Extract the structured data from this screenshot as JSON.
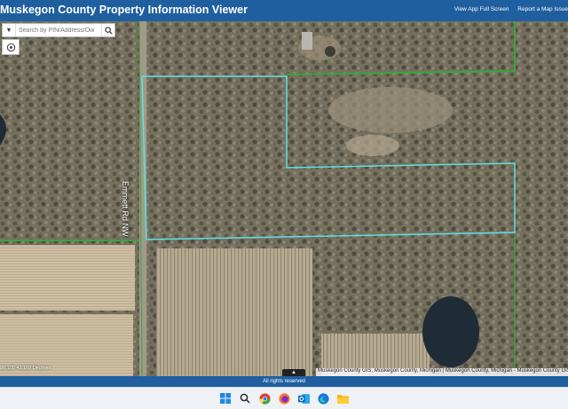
{
  "header": {
    "title": "Muskegon County Property Information Viewer",
    "links": [
      "View App Full Screen",
      "Report a Map Issue"
    ]
  },
  "search": {
    "placeholder": "Search by PIN/Address/Ow"
  },
  "map": {
    "road_label": "Emmett Rd NW",
    "coordinates": "86.105 43.168 Degrees",
    "attribution": "Muskegon County GIS, Muskegon County, Michigan | Muskegon County, Michigan - Muskegon County GIS",
    "parcel_color": "#5fe0e8",
    "boundary_color": "#3aa53a"
  },
  "footer": {
    "text": "All rights reserved"
  },
  "taskbar": {
    "icons": [
      "windows-icon",
      "search-icon",
      "chrome-icon",
      "firefox-icon",
      "outlook-icon",
      "edge-icon",
      "file-explorer-icon"
    ]
  },
  "colors": {
    "header": "#1f5fa0"
  }
}
